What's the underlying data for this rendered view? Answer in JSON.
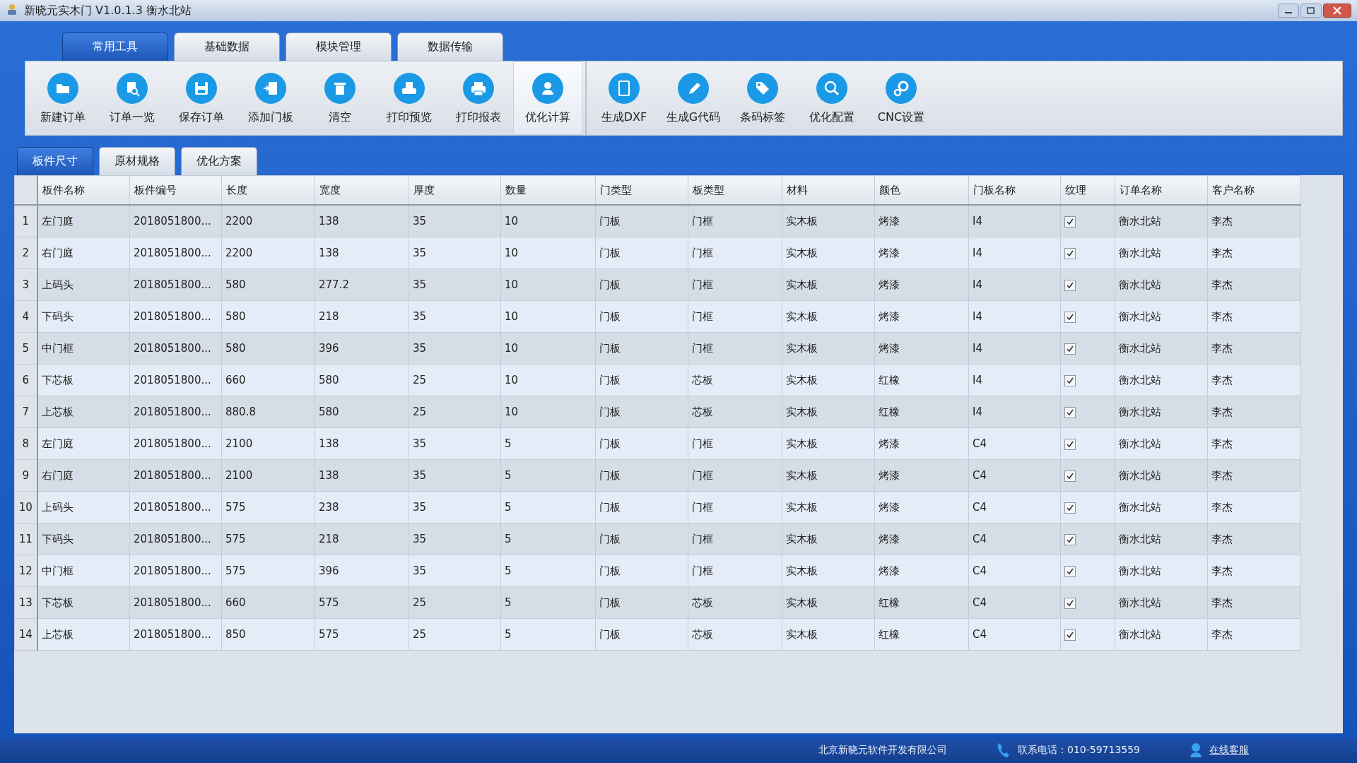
{
  "window": {
    "title": "新晓元实木门 V1.0.1.3 衡水北站"
  },
  "tabs": [
    {
      "label": "常用工具",
      "selected": true
    },
    {
      "label": "基础数据",
      "selected": false
    },
    {
      "label": "模块管理",
      "selected": false
    },
    {
      "label": "数据传输",
      "selected": false
    }
  ],
  "toolbar": [
    {
      "label": "新建订单",
      "highlighted": false
    },
    {
      "label": "订单一览",
      "highlighted": false
    },
    {
      "label": "保存订单",
      "highlighted": false
    },
    {
      "label": "添加门板",
      "highlighted": false
    },
    {
      "label": "清空",
      "highlighted": false
    },
    {
      "label": "打印预览",
      "highlighted": false
    },
    {
      "label": "打印报表",
      "highlighted": false
    },
    {
      "label": "优化计算",
      "highlighted": true
    },
    {
      "label": "生成DXF",
      "highlighted": false
    },
    {
      "label": "生成G代码",
      "highlighted": false
    },
    {
      "label": "条码标签",
      "highlighted": false
    },
    {
      "label": "优化配置",
      "highlighted": false
    },
    {
      "label": "CNC设置",
      "highlighted": false
    }
  ],
  "sub_tabs": [
    {
      "label": "板件尺寸",
      "selected": true
    },
    {
      "label": "原材规格",
      "selected": false
    },
    {
      "label": "优化方案",
      "selected": false
    }
  ],
  "table": {
    "columns": [
      "板件名称",
      "板件编号",
      "长度",
      "宽度",
      "厚度",
      "数量",
      "门类型",
      "板类型",
      "材料",
      "颜色",
      "门板名称",
      "纹理",
      "订单名称",
      "客户名称"
    ],
    "rows": [
      {
        "number": "1",
        "cells": [
          "左门庭",
          "2018051800...",
          "2200",
          "138",
          "35",
          "10",
          "门板",
          "门框",
          "实木板",
          "烤漆",
          "I4"
        ],
        "texture": true,
        "order": "衡水北站",
        "customer": "李杰"
      },
      {
        "number": "2",
        "cells": [
          "右门庭",
          "2018051800...",
          "2200",
          "138",
          "35",
          "10",
          "门板",
          "门框",
          "实木板",
          "烤漆",
          "I4"
        ],
        "texture": true,
        "order": "衡水北站",
        "customer": "李杰"
      },
      {
        "number": "3",
        "cells": [
          "上码头",
          "2018051800...",
          "580",
          "277.2",
          "35",
          "10",
          "门板",
          "门框",
          "实木板",
          "烤漆",
          "I4"
        ],
        "texture": true,
        "order": "衡水北站",
        "customer": "李杰"
      },
      {
        "number": "4",
        "cells": [
          "下码头",
          "2018051800...",
          "580",
          "218",
          "35",
          "10",
          "门板",
          "门框",
          "实木板",
          "烤漆",
          "I4"
        ],
        "texture": true,
        "order": "衡水北站",
        "customer": "李杰"
      },
      {
        "number": "5",
        "cells": [
          "中门框",
          "2018051800...",
          "580",
          "396",
          "35",
          "10",
          "门板",
          "门框",
          "实木板",
          "烤漆",
          "I4"
        ],
        "texture": true,
        "order": "衡水北站",
        "customer": "李杰"
      },
      {
        "number": "6",
        "cells": [
          "下芯板",
          "2018051800...",
          "660",
          "580",
          "25",
          "10",
          "门板",
          "芯板",
          "实木板",
          "红橡",
          "I4"
        ],
        "texture": true,
        "order": "衡水北站",
        "customer": "李杰"
      },
      {
        "number": "7",
        "cells": [
          "上芯板",
          "2018051800...",
          "880.8",
          "580",
          "25",
          "10",
          "门板",
          "芯板",
          "实木板",
          "红橡",
          "I4"
        ],
        "texture": true,
        "order": "衡水北站",
        "customer": "李杰"
      },
      {
        "number": "8",
        "cells": [
          "左门庭",
          "2018051800...",
          "2100",
          "138",
          "35",
          "5",
          "门板",
          "门框",
          "实木板",
          "烤漆",
          "C4"
        ],
        "texture": true,
        "order": "衡水北站",
        "customer": "李杰"
      },
      {
        "number": "9",
        "cells": [
          "右门庭",
          "2018051800...",
          "2100",
          "138",
          "35",
          "5",
          "门板",
          "门框",
          "实木板",
          "烤漆",
          "C4"
        ],
        "texture": true,
        "order": "衡水北站",
        "customer": "李杰"
      },
      {
        "number": "10",
        "cells": [
          "上码头",
          "2018051800...",
          "575",
          "238",
          "35",
          "5",
          "门板",
          "门框",
          "实木板",
          "烤漆",
          "C4"
        ],
        "texture": true,
        "order": "衡水北站",
        "customer": "李杰"
      },
      {
        "number": "11",
        "cells": [
          "下码头",
          "2018051800...",
          "575",
          "218",
          "35",
          "5",
          "门板",
          "门框",
          "实木板",
          "烤漆",
          "C4"
        ],
        "texture": true,
        "order": "衡水北站",
        "customer": "李杰"
      },
      {
        "number": "12",
        "cells": [
          "中门框",
          "2018051800...",
          "575",
          "396",
          "35",
          "5",
          "门板",
          "门框",
          "实木板",
          "烤漆",
          "C4"
        ],
        "texture": true,
        "order": "衡水北站",
        "customer": "李杰"
      },
      {
        "number": "13",
        "cells": [
          "下芯板",
          "2018051800...",
          "660",
          "575",
          "25",
          "5",
          "门板",
          "芯板",
          "实木板",
          "红橡",
          "C4"
        ],
        "texture": true,
        "order": "衡水北站",
        "customer": "李杰"
      },
      {
        "number": "14",
        "cells": [
          "上芯板",
          "2018051800...",
          "850",
          "575",
          "25",
          "5",
          "门板",
          "芯板",
          "实木板",
          "红橡",
          "C4"
        ],
        "texture": true,
        "order": "衡水北站",
        "customer": "李杰"
      }
    ]
  },
  "status_bar": {
    "company": "北京新晓元软件开发有限公司",
    "phone": "联系电话：010-59713559",
    "support_link": "在线客服"
  }
}
